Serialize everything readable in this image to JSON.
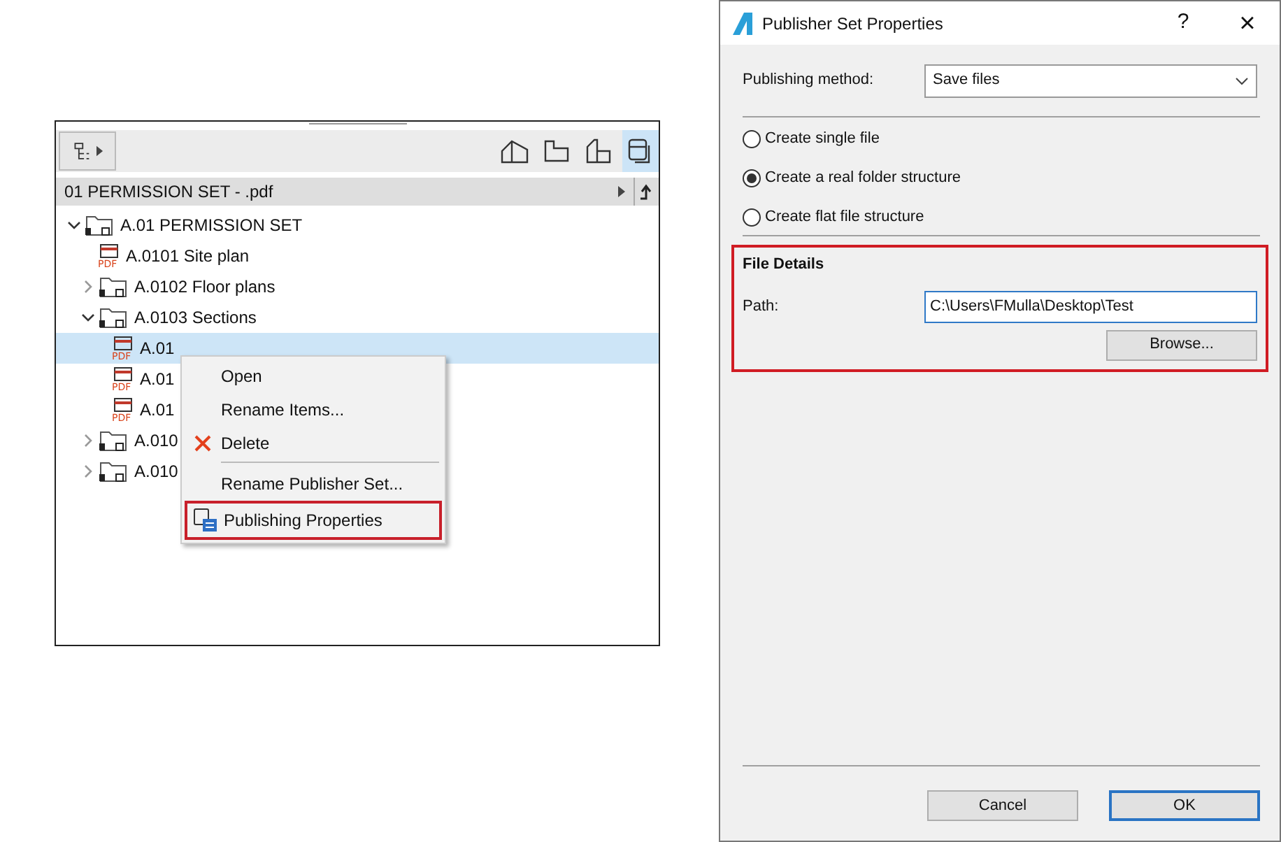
{
  "navigator": {
    "toolbar_icons": [
      {
        "kind": "house",
        "selected": false
      },
      {
        "kind": "plan",
        "selected": false
      },
      {
        "kind": "sheet",
        "selected": false
      },
      {
        "kind": "publisher",
        "selected": true
      }
    ],
    "path_bar": {
      "label": "01 PERMISSION SET - .pdf"
    },
    "tree": [
      {
        "kind": "folder",
        "label": "A.01 PERMISSION SET",
        "expanded": true,
        "selected": false,
        "children": [
          {
            "kind": "pdf",
            "icon_text": "PDF",
            "label": "A.0101 Site plan",
            "selected": false
          },
          {
            "kind": "folder",
            "label": "A.0102 Floor plans",
            "expanded": false,
            "selected": false
          },
          {
            "kind": "folder",
            "label": "A.0103 Sections",
            "expanded": true,
            "selected": false,
            "children": [
              {
                "kind": "pdf",
                "icon_text": "PDF",
                "label": "A.01",
                "selected": true
              },
              {
                "kind": "pdf",
                "icon_text": "PDF",
                "label": "A.01",
                "selected": false
              },
              {
                "kind": "pdf",
                "icon_text": "PDF",
                "label": "A.01",
                "selected": false
              }
            ]
          },
          {
            "kind": "folder",
            "label": "A.010",
            "expanded": false,
            "selected": false
          },
          {
            "kind": "folder",
            "label": "A.010",
            "expanded": false,
            "selected": false
          }
        ]
      }
    ]
  },
  "context_menu": {
    "items": [
      {
        "label": "Open",
        "kind": "plain",
        "divider_after": false,
        "outlined": false
      },
      {
        "label": "Rename Items...",
        "kind": "plain",
        "divider_after": false,
        "outlined": false
      },
      {
        "label": "Delete",
        "kind": "delete",
        "divider_after": true,
        "outlined": false
      },
      {
        "label": "Rename Publisher Set...",
        "kind": "plain",
        "divider_after": false,
        "outlined": false
      },
      {
        "label": "Publishing Properties",
        "kind": "publish",
        "divider_after": false,
        "outlined": true
      }
    ]
  },
  "dialog": {
    "title": "Publisher Set Properties",
    "help": "?",
    "close": "×",
    "method": {
      "label": "Publishing method:",
      "value": "Save files"
    },
    "options": [
      {
        "label": "Create single file",
        "selected": false
      },
      {
        "label": "Create a real folder structure",
        "selected": true
      },
      {
        "label": "Create flat file structure",
        "selected": false
      }
    ],
    "file_details": {
      "title": "File Details",
      "highlighted": true,
      "path_label": "Path:",
      "path_value": "C:\\Users\\FMulla\\Desktop\\Test",
      "browse": "Browse..."
    },
    "buttons": [
      {
        "label": "Cancel",
        "default": false
      },
      {
        "label": "OK",
        "default": true
      }
    ]
  }
}
